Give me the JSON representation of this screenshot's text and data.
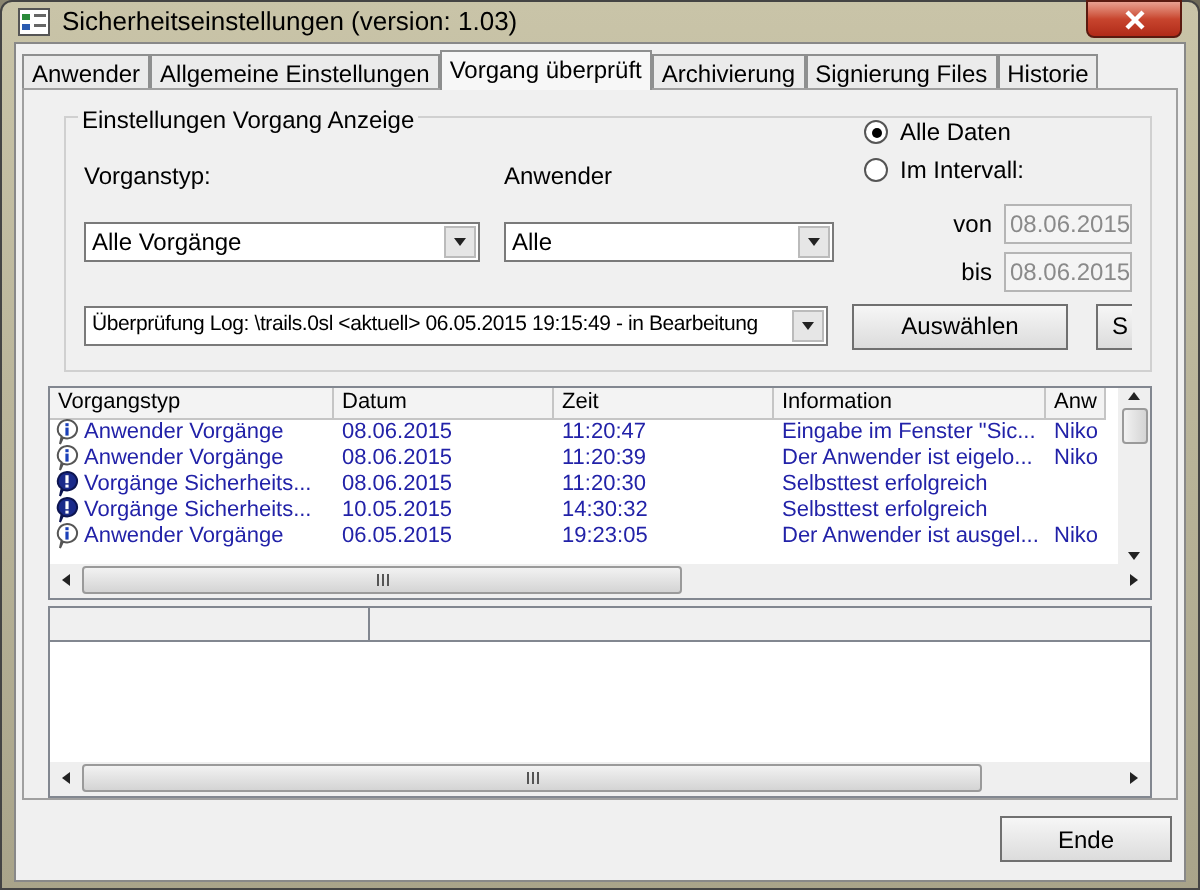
{
  "window": {
    "title": "Sicherheitseinstellungen (version: 1.03)"
  },
  "tabs": [
    {
      "label": "Anwender",
      "selected": false
    },
    {
      "label": "Allgemeine Einstellungen",
      "selected": false
    },
    {
      "label": "Vorgang überprüft",
      "selected": true
    },
    {
      "label": "Archivierung",
      "selected": false
    },
    {
      "label": "Signierung Files",
      "selected": false
    },
    {
      "label": "Historie",
      "selected": false
    }
  ],
  "group": {
    "title": "Einstellungen Vorgang Anzeige",
    "type_label": "Vorganstyp:",
    "type_value": "Alle Vorgänge",
    "user_label": "Anwender",
    "user_value": "Alle",
    "range_options": [
      {
        "label": "Alle Daten",
        "selected": true
      },
      {
        "label": "Im Intervall:",
        "selected": false
      }
    ],
    "from_label": "von",
    "from_value": "08.06.2015",
    "to_label": "bis",
    "to_value": "08.06.2015",
    "dates_disabled": true,
    "log_value": "Überprüfung Log: \\trails.0sl <aktuell> 06.05.2015 19:15:49 - in Bearbeitung",
    "buttons": [
      "Auswählen",
      "S"
    ]
  },
  "log_table": {
    "columns": [
      "Vorgangstyp",
      "Datum",
      "Zeit",
      "Information",
      "Anw"
    ],
    "rows": [
      {
        "kind": "info",
        "cells": [
          "Anwender Vorgänge",
          "08.06.2015",
          "11:20:47",
          "Eingabe im Fenster \"Sic...",
          "Niko"
        ]
      },
      {
        "kind": "info",
        "cells": [
          "Anwender Vorgänge",
          "08.06.2015",
          "11:20:39",
          "Der Anwender ist eigelo...",
          "Niko"
        ]
      },
      {
        "kind": "alert",
        "cells": [
          "Vorgänge Sicherheits...",
          "08.06.2015",
          "11:20:30",
          "Selbsttest erfolgreich",
          ""
        ]
      },
      {
        "kind": "alert",
        "cells": [
          "Vorgänge Sicherheits...",
          "10.05.2015",
          "14:30:32",
          "Selbsttest erfolgreich",
          ""
        ]
      },
      {
        "kind": "info",
        "cells": [
          "Anwender Vorgänge",
          "06.05.2015",
          "19:23:05",
          "Der Anwender ist ausgel...",
          "Niko"
        ]
      }
    ]
  },
  "footer_button": "Ende"
}
